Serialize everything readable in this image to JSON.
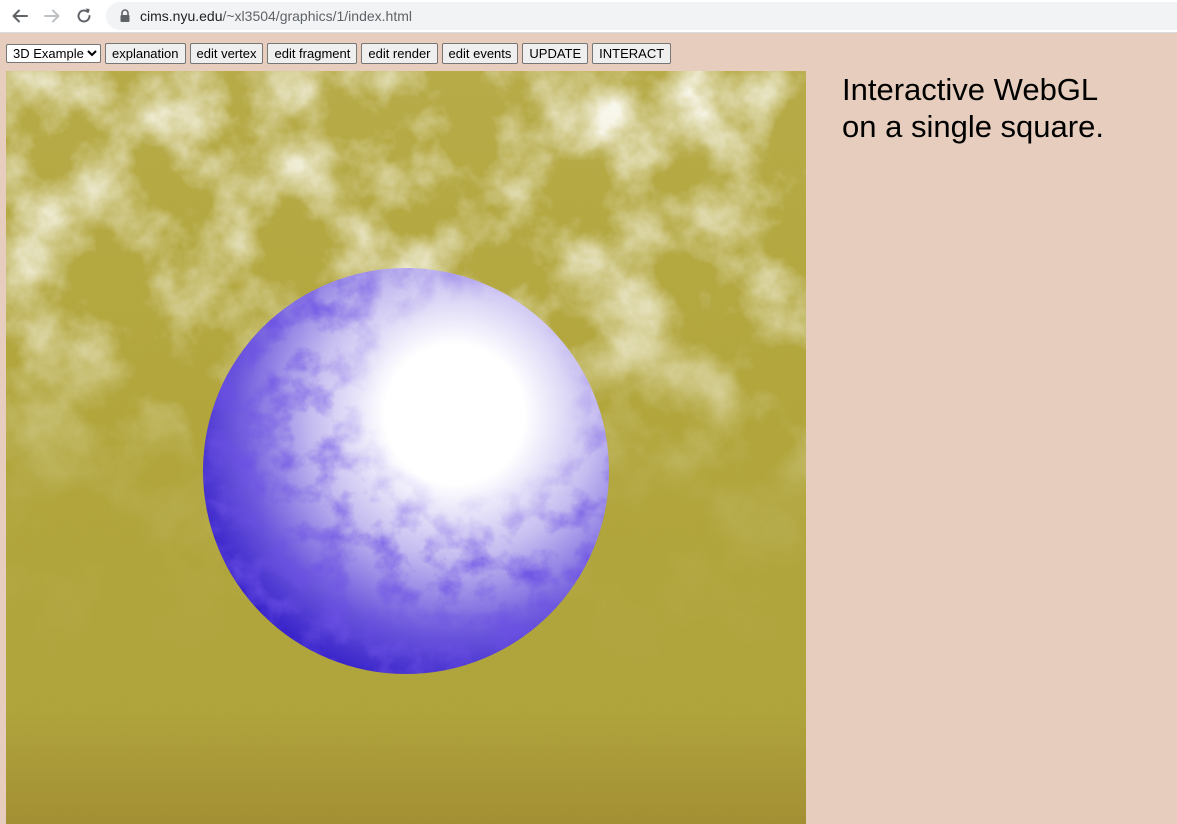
{
  "browser": {
    "url_domain": "cims.nyu.edu",
    "url_path": "/~xl3504/graphics/1/index.html",
    "icons": [
      "back-arrow-icon",
      "forward-arrow-icon",
      "reload-icon",
      "lock-icon"
    ]
  },
  "toolbar": {
    "example_select": {
      "selected": "3D Example"
    },
    "buttons": {
      "explanation": "explanation",
      "edit_vertex": "edit vertex",
      "edit_fragment": "edit fragment",
      "edit_render": "edit render",
      "edit_events": "edit events",
      "update": "UPDATE",
      "interact": "INTERACT"
    }
  },
  "side": {
    "line1": "Interactive WebGL",
    "line2": "on a single square."
  },
  "colors": {
    "page_background": "#e6cdbd",
    "canvas_ground": "#b0a63a",
    "cloud": "#f4f2e2",
    "sphere_dark": "#1a0fc0",
    "sphere_light": "#ffffff"
  }
}
